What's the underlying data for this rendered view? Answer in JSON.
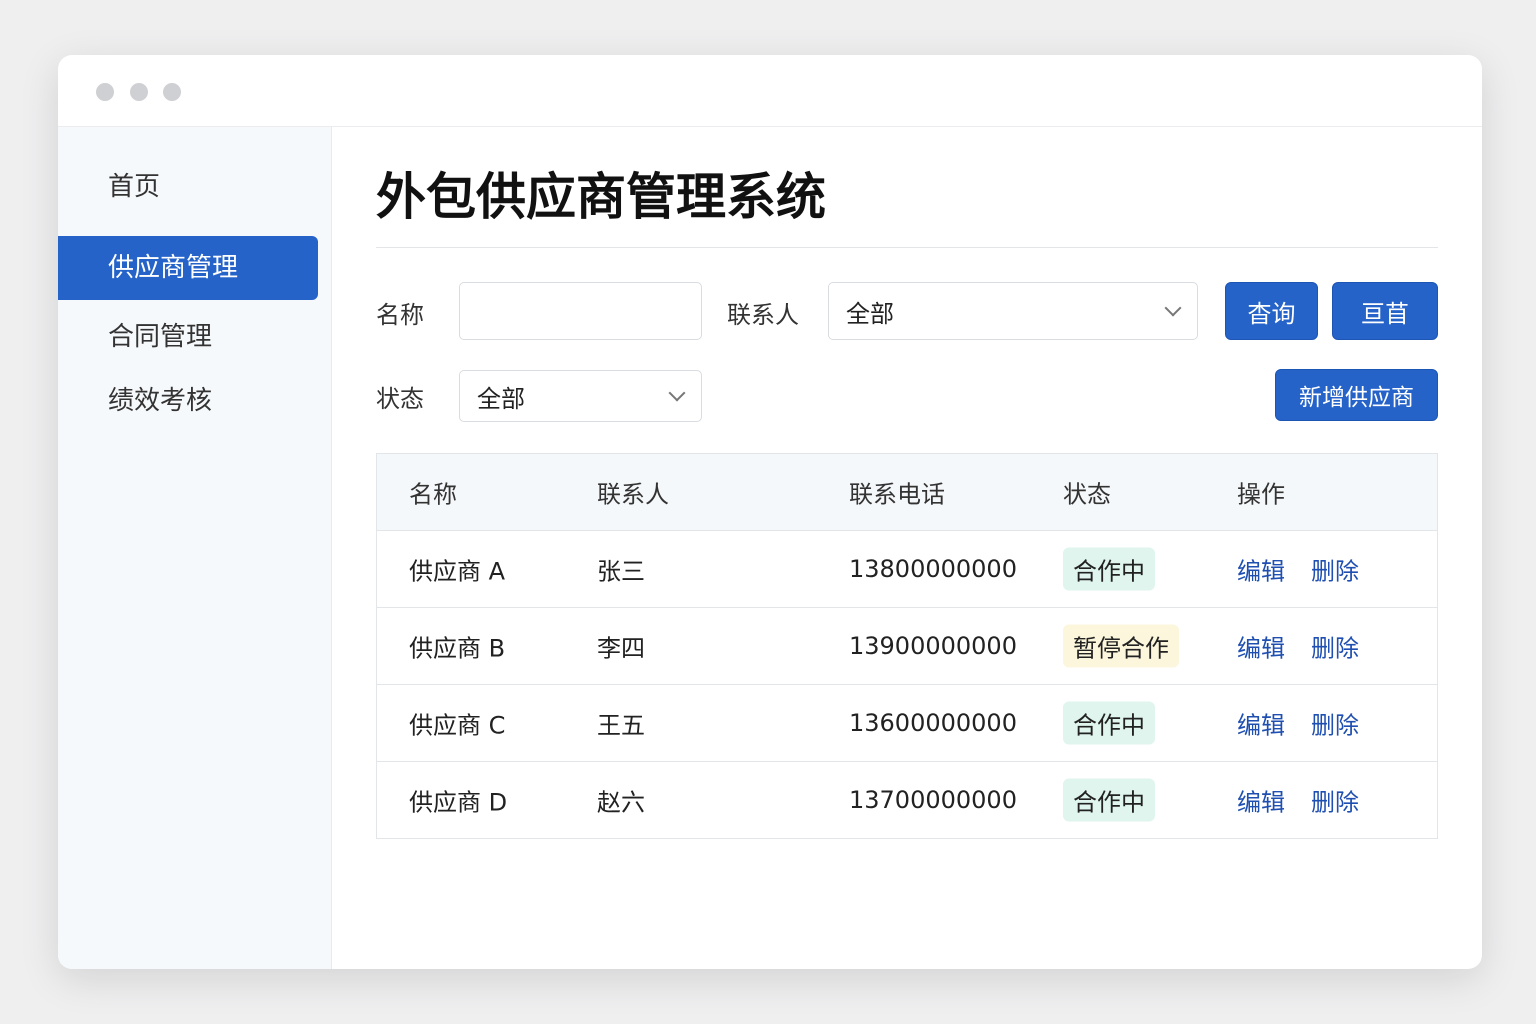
{
  "sidebar": {
    "items": [
      {
        "label": "首页"
      },
      {
        "label": "供应商管理"
      },
      {
        "label": "合同管理"
      },
      {
        "label": "绩效考核"
      }
    ]
  },
  "main": {
    "title": "外包供应商管理系统"
  },
  "filters": {
    "name_label": "名称",
    "name_value": "",
    "contact_label": "联系人",
    "contact_value": "全部",
    "status_label": "状态",
    "status_value": "全部",
    "search_label": "杳询",
    "reset_label": "亘苜",
    "add_label": "新增供应商"
  },
  "table": {
    "headers": [
      "名称",
      "联系人",
      "联系电话",
      "状态",
      "操作"
    ],
    "rows": [
      {
        "name": "供应商 A",
        "contact": "张三",
        "phone": "13800000000",
        "status": "合作中",
        "edit": "编辑",
        "delete": "删除"
      },
      {
        "name": "供应商 B",
        "contact": "李四",
        "phone": "13900000000",
        "status": "暂停合作",
        "edit": "编辑",
        "delete": "删除"
      },
      {
        "name": "供应商 C",
        "contact": "王五",
        "phone": "13600000000",
        "status": "合作中",
        "edit": "编辑",
        "delete": "删除"
      },
      {
        "name": "供应商 D",
        "contact": "赵六",
        "phone": "13700000000",
        "status": "合作中",
        "edit": "编辑",
        "delete": "删除"
      }
    ]
  },
  "colors": {
    "accent": "#2563c9",
    "active_badge": "#dff5ee",
    "paused_badge": "#fbf6dc",
    "link": "#1f4fb0"
  }
}
